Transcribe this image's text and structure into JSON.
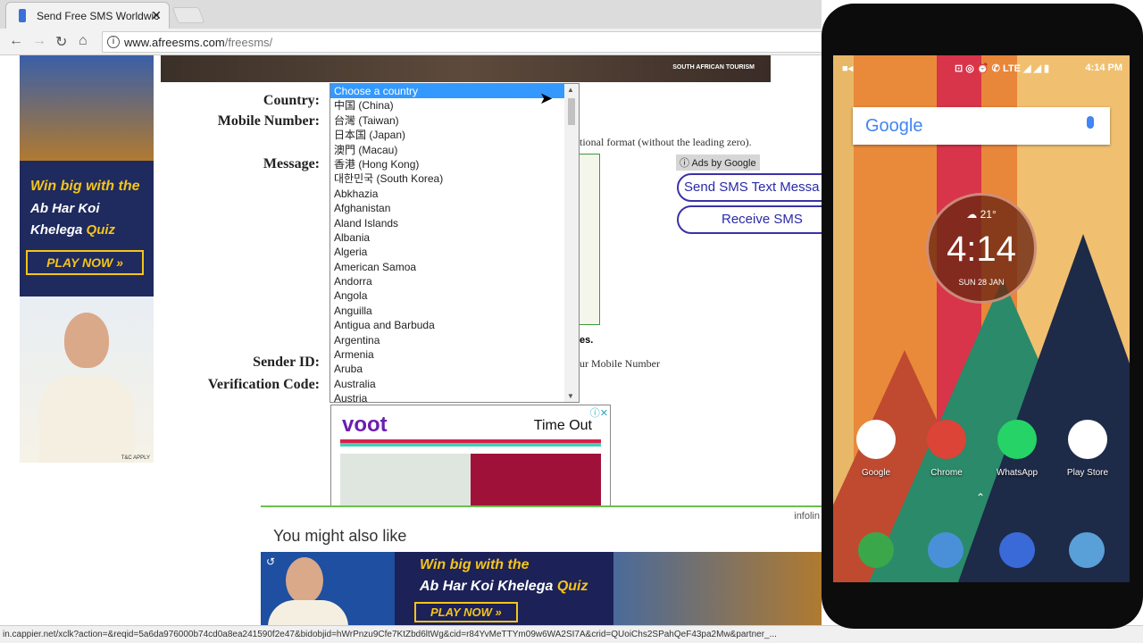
{
  "browser": {
    "tab_title": "Send Free SMS Worldwic",
    "url_host": "www.afreesms.com",
    "url_path": "/freesms/"
  },
  "banner": {
    "text": "SOUTH AFRICAN TOURISM"
  },
  "left_ad": {
    "line1": "Win big with the",
    "line2": "Ab Har Koi Khelega",
    "line2_accent": "Quiz",
    "cta": "PLAY NOW »",
    "tc": "T&C APPLY"
  },
  "form": {
    "country_label": "Country:",
    "mobile_label": "Mobile Number:",
    "message_label": "Message:",
    "sender_label": "Sender ID:",
    "verification_label": "Verification Code:",
    "mobile_hint": "tional format (without the leading zero).",
    "chars_hint": "es.",
    "sender_hint": "ur Mobile Number"
  },
  "country_dropdown": {
    "items": [
      "Choose a country",
      "中国 (China)",
      "台灣 (Taiwan)",
      "日本国 (Japan)",
      "澳門 (Macau)",
      "香港 (Hong Kong)",
      "대한민국 (South Korea)",
      "Abkhazia",
      "Afghanistan",
      "Aland Islands",
      "Albania",
      "Algeria",
      "American Samoa",
      "Andorra",
      "Angola",
      "Anguilla",
      "Antigua and Barbuda",
      "Argentina",
      "Armenia",
      "Aruba",
      "Australia",
      "Austria"
    ]
  },
  "right_ads": {
    "ads_by": "Ads by Google",
    "send_sms": "Send SMS Text Messa",
    "receive_sms": "Receive SMS"
  },
  "voot_ad": {
    "logo": "voot",
    "title": "Time Out"
  },
  "bottom_ad": {
    "heading": "You might also like",
    "brand": "infolin",
    "line1": "Win big with the",
    "line2": "Ab Har Koi Khelega",
    "line2_accent": "Quiz",
    "cta": "PLAY NOW »"
  },
  "status_url": "in.cappier.net/xclk?action=&reqid=5a6da976000b74cd0a8ea241590f2e47&bidobjid=hWrPnzu9Cfe7KtZbd6ltWg&cid=r84YvMeTTYm09w6WA2SI7A&crid=QUoiChs2SPahQeF43pa2Mw&partner_...",
  "phone": {
    "status_time": "4:14 PM",
    "network": "LTE",
    "search_logo": "Google",
    "weather": "21°",
    "clock": "4:14",
    "date": "SUN 28 JAN",
    "apps": [
      "Google",
      "Chrome",
      "WhatsApp",
      "Play Store"
    ]
  }
}
